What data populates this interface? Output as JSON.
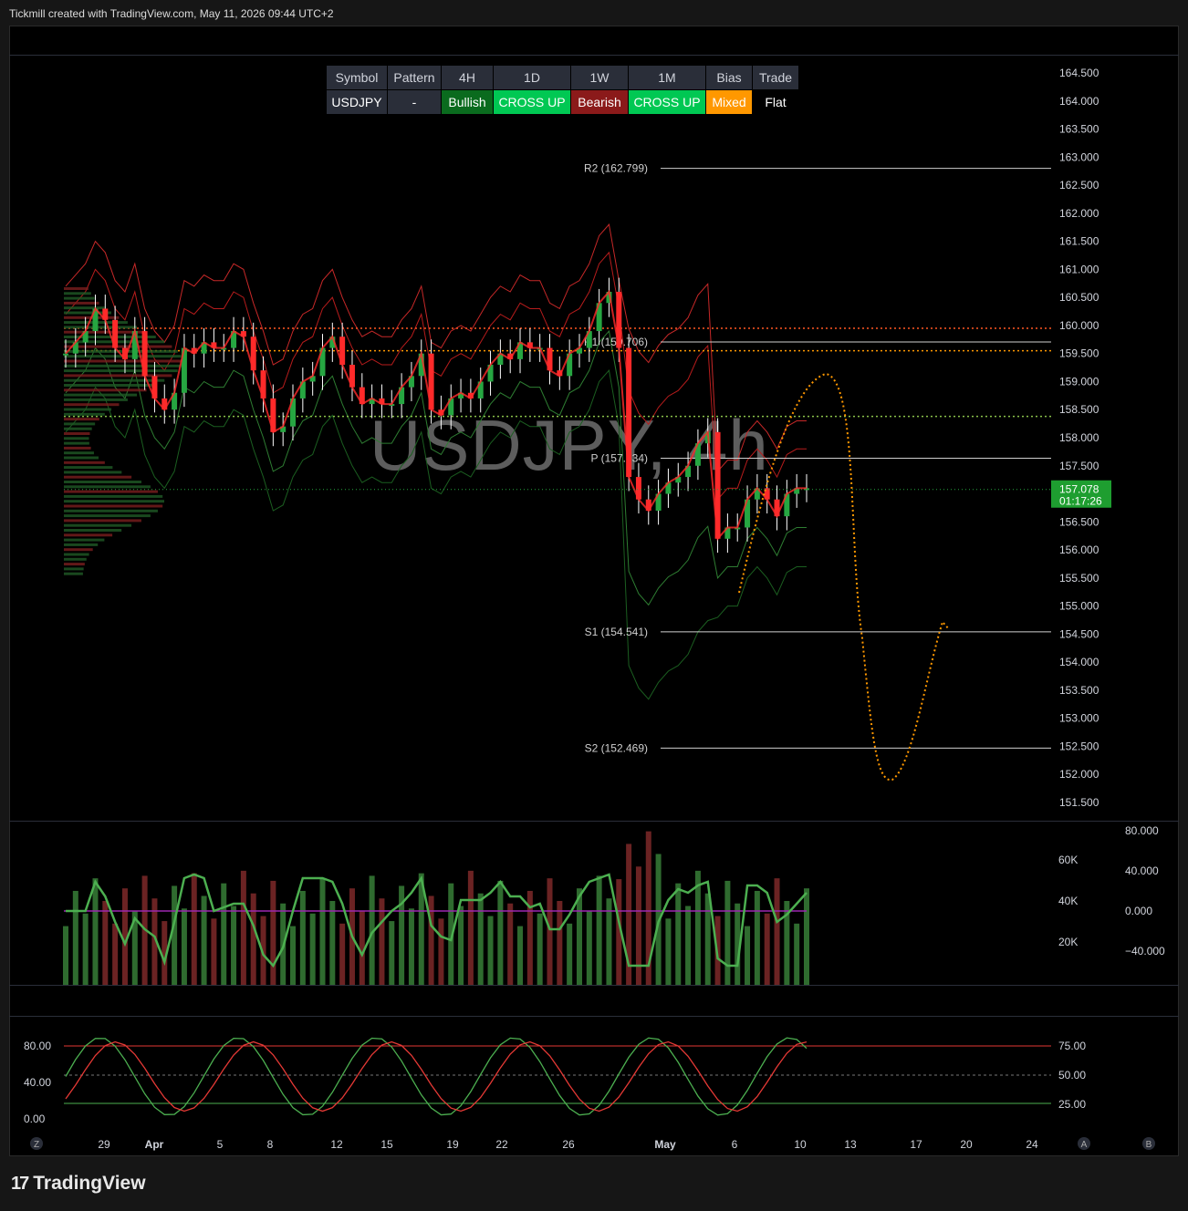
{
  "header": "Tickmill created with TradingView.com, May 11, 2026 09:44 UTC+2",
  "watermark": "USDJPY, 4h",
  "brand": "TradingView",
  "table": {
    "headers": [
      "Symbol",
      "Pattern",
      "4H",
      "1D",
      "1W",
      "1M",
      "Bias",
      "Trade"
    ],
    "values": [
      "USDJPY",
      "-",
      "Bullish",
      "CROSS UP",
      "Bearish",
      "CROSS UP",
      "Mixed",
      "Flat"
    ],
    "value_colors": [
      "#2a2e39",
      "#2a2e39",
      "#0a6b1e",
      "#00c853",
      "#8b1a1a",
      "#00c853",
      "#ff9800",
      "#000000"
    ]
  },
  "price_axis": {
    "ticks": [
      "164.500",
      "164.000",
      "163.500",
      "163.000",
      "162.500",
      "162.000",
      "161.500",
      "161.000",
      "160.500",
      "160.000",
      "159.500",
      "159.000",
      "158.500",
      "158.000",
      "157.500",
      "157.000",
      "156.500",
      "156.000",
      "155.500",
      "155.000",
      "154.500",
      "154.000",
      "153.500",
      "153.000",
      "152.500",
      "152.000",
      "151.500"
    ],
    "last_price": "157.078",
    "countdown": "01:17:26"
  },
  "pivots": [
    {
      "label": "R2 (162.799)",
      "value": 162.799
    },
    {
      "label": "R1 (159.706)",
      "value": 159.706
    },
    {
      "label": "P (157.634)",
      "value": 157.634
    },
    {
      "label": "S1 (154.541)",
      "value": 154.541
    },
    {
      "label": "S2 (152.469)",
      "value": 152.469
    }
  ],
  "time_axis": [
    "29",
    "Apr",
    "5",
    "8",
    "12",
    "15",
    "19",
    "22",
    "26",
    "May",
    "6",
    "10",
    "13",
    "17",
    "20",
    "24"
  ],
  "axis_buttons": [
    "Z",
    "A",
    "B"
  ],
  "volume_axis": [
    "60K",
    "40K",
    "20K"
  ],
  "osc_axis": [
    "80.000",
    "40.000",
    "0.000",
    "−40.000"
  ],
  "stoch_left_axis": [
    "80.00",
    "40.00",
    "0.00"
  ],
  "stoch_right_axis": [
    "75.00",
    "50.00",
    "25.00"
  ],
  "colors": {
    "bull": "#26a641",
    "bear": "#ff2a2a",
    "accent": "#ff9800",
    "level_red": "#ff5722",
    "level_green": "#8bc34a"
  },
  "chart_data": {
    "type": "candlestick",
    "title": "USDJPY, 4h",
    "ylim": [
      151.2,
      164.7
    ],
    "close_series": [
      159.5,
      159.7,
      159.9,
      160.3,
      160.1,
      159.6,
      159.4,
      159.9,
      159.1,
      158.7,
      158.5,
      158.8,
      159.6,
      159.5,
      159.7,
      159.6,
      159.6,
      159.9,
      159.8,
      159.2,
      158.7,
      158.1,
      158.2,
      158.7,
      159.0,
      159.1,
      159.6,
      159.8,
      159.3,
      158.9,
      158.6,
      158.7,
      158.6,
      158.6,
      158.9,
      159.1,
      159.5,
      158.5,
      158.4,
      158.7,
      158.8,
      158.7,
      159.0,
      159.3,
      159.5,
      159.4,
      159.7,
      159.6,
      159.6,
      159.2,
      159.1,
      159.5,
      159.6,
      159.9,
      160.4,
      160.6,
      159.6,
      157.3,
      156.9,
      156.7,
      157.0,
      157.2,
      157.3,
      157.5,
      157.9,
      158.1,
      156.2,
      156.4,
      156.4,
      156.9,
      157.1,
      156.9,
      156.6,
      157.0,
      157.1,
      157.1
    ],
    "current_price": 157.078,
    "level_lines": [
      159.95,
      159.55,
      158.38
    ],
    "projection": "dotted path up to ~159.1 then down to ~151.9 then up to ~154.7"
  }
}
